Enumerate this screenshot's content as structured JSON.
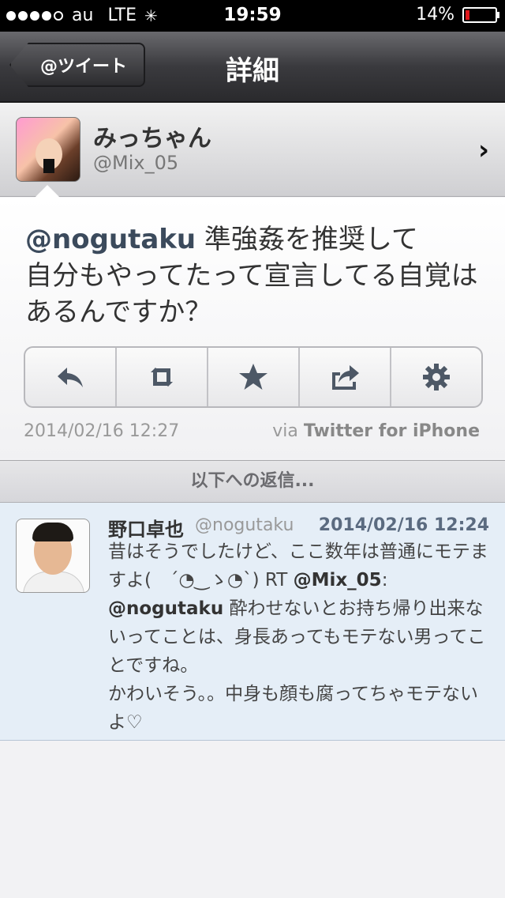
{
  "status_bar": {
    "carrier": "au",
    "network": "LTE",
    "time": "19:59",
    "battery_percent": "14%",
    "battery_level": 0.14,
    "signal_bars_filled": 4,
    "signal_bars_total": 5
  },
  "nav": {
    "back_label": "@ツイート",
    "title": "詳細"
  },
  "author": {
    "name": "みっちゃん",
    "handle": "@Mix_05"
  },
  "tweet": {
    "mention": "@nogutaku",
    "text": " 準強姦を推奨して\n自分もやってたって宣言してる自覚はあるんですか？",
    "date": "2014/02/16 12:27",
    "via_prefix": "via",
    "via_client": "Twitter for iPhone",
    "actions": [
      "reply-icon",
      "retweet-icon",
      "star-icon",
      "share-icon",
      "gear-icon"
    ]
  },
  "reply_section": {
    "header": "以下への返信..."
  },
  "reply": {
    "name": "野口卓也",
    "handle": "@nogutaku",
    "date": "2014/02/16 12:24",
    "text_part1": "昔はそうでしたけど、ここ数年は普通にモテますよ(　´◔‿ゝ◔`) RT ",
    "mention1": "@Mix_05",
    "text_part2": ": ",
    "mention2": "@nogutaku",
    "text_part3": " 酔わせないとお持ち帰り出来ないってことは、身長あってもモテない男ってことですね。\nかわいそう。。中身も顔も腐ってちゃモテないよ♡"
  },
  "colors": {
    "nav_bar": "#2a2a2d",
    "reply_bg": "#e5eef7",
    "battery_low": "#e0171b",
    "mention": "#3b4a5c"
  }
}
